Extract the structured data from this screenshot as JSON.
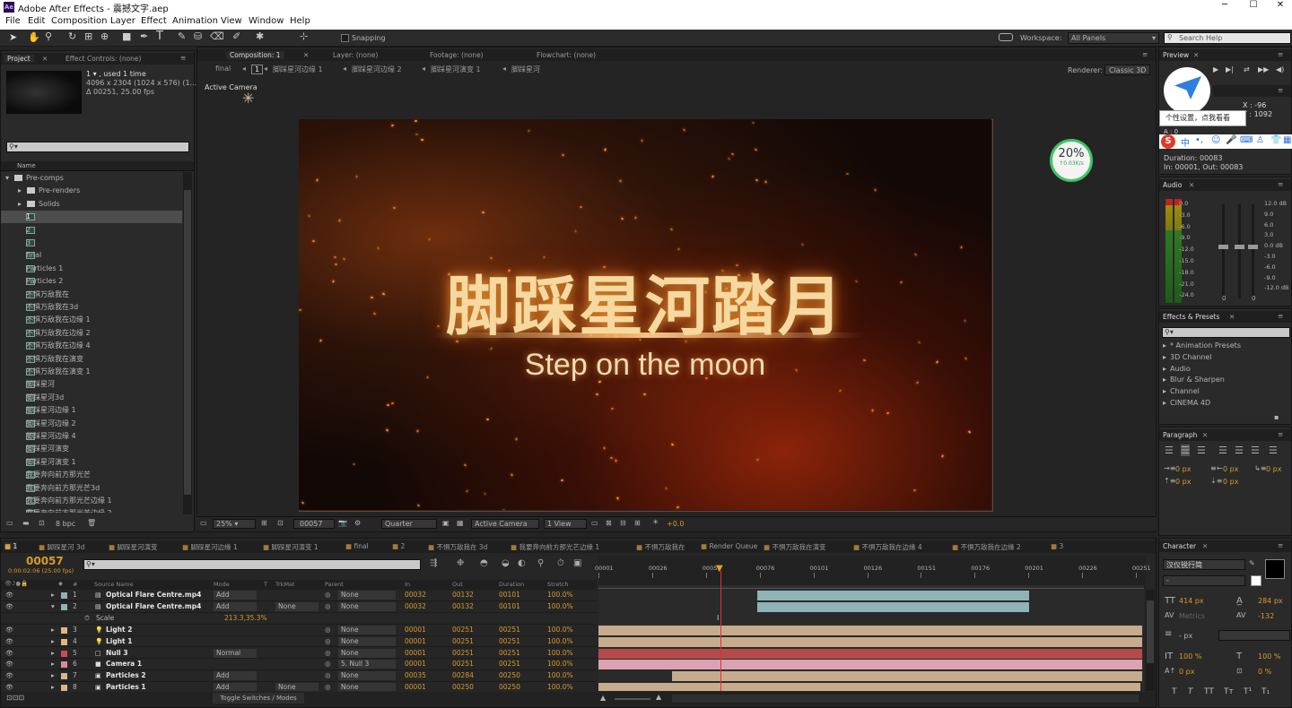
{
  "window": {
    "title": "Adobe After Effects - 震撼文字.aep"
  },
  "menu": [
    "File",
    "Edit",
    "Composition",
    "Layer",
    "Effect",
    "Animation",
    "View",
    "Window",
    "Help"
  ],
  "toolbar": {
    "snapping": "Snapping",
    "workspace_label": "Workspace:",
    "workspace_value": "All Panels",
    "search_placeholder": "Search Help"
  },
  "project": {
    "tab_project": "Project",
    "tab_effect_controls": "Effect Controls: (none)",
    "item_name": "1 ▾ , used 1 time",
    "item_size": "4096 x 2304  (1024 x 576) (1...",
    "item_duration": "Δ 00251, 25.00 fps",
    "col_name": "Name",
    "bpc": "8 bpc",
    "tree": [
      {
        "label": "Pre-comps",
        "level": 0,
        "kind": "folder",
        "open": true
      },
      {
        "label": "Pre-renders",
        "level": 1,
        "kind": "folder"
      },
      {
        "label": "Solids",
        "level": 1,
        "kind": "folder"
      },
      {
        "label": "1",
        "level": 1,
        "kind": "comp",
        "selected": true
      },
      {
        "label": "2",
        "level": 1,
        "kind": "comp"
      },
      {
        "label": "3",
        "level": 1,
        "kind": "comp"
      },
      {
        "label": "final",
        "level": 1,
        "kind": "comp"
      },
      {
        "label": "Particles 1",
        "level": 1,
        "kind": "comp"
      },
      {
        "label": "Particles 2",
        "level": 1,
        "kind": "comp"
      },
      {
        "label": "不惧万敌我在",
        "level": 1,
        "kind": "comp"
      },
      {
        "label": "不惧万敌我在3d",
        "level": 1,
        "kind": "comp"
      },
      {
        "label": "不惧万敌我在边缘 1",
        "level": 1,
        "kind": "comp"
      },
      {
        "label": "不惧万敌我在边缘 2",
        "level": 1,
        "kind": "comp"
      },
      {
        "label": "不惧万敌我在边缘 4",
        "level": 1,
        "kind": "comp"
      },
      {
        "label": "不惧万敌我在演变",
        "level": 1,
        "kind": "comp"
      },
      {
        "label": "不惧万敌我在演变 1",
        "level": 1,
        "kind": "comp"
      },
      {
        "label": "脚踩星河",
        "level": 1,
        "kind": "comp"
      },
      {
        "label": "脚踩星河3d",
        "level": 1,
        "kind": "comp"
      },
      {
        "label": "脚踩星河边缘 1",
        "level": 1,
        "kind": "comp"
      },
      {
        "label": "脚踩星河边缘 2",
        "level": 1,
        "kind": "comp"
      },
      {
        "label": "脚踩星河边缘 4",
        "level": 1,
        "kind": "comp"
      },
      {
        "label": "脚踩星河演变",
        "level": 1,
        "kind": "comp"
      },
      {
        "label": "脚踩星河演变 1",
        "level": 1,
        "kind": "comp"
      },
      {
        "label": "我要奔向前方那光芒",
        "level": 1,
        "kind": "comp"
      },
      {
        "label": "我要奔向前方那光芒3d",
        "level": 1,
        "kind": "comp"
      },
      {
        "label": "我要奔向前方那光芒边缘 1",
        "level": 1,
        "kind": "comp"
      },
      {
        "label": "我要奔向前方那光芒边缘 2",
        "level": 1,
        "kind": "comp"
      }
    ]
  },
  "viewer": {
    "tab_composition": "Composition: 1",
    "tab_layer": "Layer: (none)",
    "tab_footage": "Footage: (none)",
    "tab_flowchart": "Flowchart: (none)",
    "breadcrumb": [
      "final",
      "1",
      "脚踩星河边缘 1",
      "脚踩星河边缘 2",
      "脚踩星河演变 1",
      "脚踩星河"
    ],
    "renderer_label": "Renderer:",
    "renderer_value": "Classic 3D",
    "active_camera": "Active Camera",
    "title_cn": "脚踩星河踏月",
    "title_en": "Step on the moon",
    "speed_percent": "20%",
    "speed_rate": "0.03K/s",
    "zoom": "25%",
    "timecode": "00057",
    "resolution": "Quarter",
    "view_camera": "Active Camera",
    "view_layout": "1 View",
    "exposure": "+0.0"
  },
  "preview": {
    "tab": "Preview",
    "tooltip": "个性设置，点我看看",
    "info_x": "X : -96",
    "info_y": "Y : 1092",
    "info_a": "A : 0",
    "duration": "Duration: 00083",
    "in_out": "In: 00001, Out: 00083"
  },
  "audio": {
    "tab": "Audio",
    "left_scale": [
      "0.0",
      "-3.0",
      "-6.0",
      "-9.0",
      "-12.0",
      "-15.0",
      "-18.0",
      "-21.0",
      "-24.0"
    ],
    "right_scale": [
      "12.0 dB",
      "9.0",
      "6.0",
      "3.0",
      "0.0 dB",
      "-3.0",
      "-6.0",
      "-9.0",
      "-12.0 dB"
    ],
    "bottom_left": "0",
    "bottom_right": "0"
  },
  "effects": {
    "tab": "Effects & Presets",
    "items": [
      "* Animation Presets",
      "3D Channel",
      "Audio",
      "Blur & Sharpen",
      "Channel",
      "CINEMA 4D"
    ]
  },
  "paragraph": {
    "tab": "Paragraph",
    "values": [
      "0 px",
      "0 px",
      "0 px",
      "0 px",
      "0 px"
    ]
  },
  "character": {
    "tab": "Character",
    "font": "汉仪锐行简",
    "style": "-",
    "size": "414 px",
    "leading": "284 px",
    "tracking_label": "Metrics",
    "tracking": "-132",
    "stroke": "- px",
    "vscale": "100 %",
    "hscale": "100 %",
    "baseline": "0 px",
    "tsume": "0 %"
  },
  "timeline": {
    "tabs": [
      "1",
      "脚踩星河 3d",
      "脚踩星河演变",
      "脚踩星河边缘 1",
      "脚踩星河演变 1",
      "final",
      "2",
      "不惧万敌我在 3d",
      "我要奔向前方那光芒边缘 1",
      "不惧万敌我在",
      "Render Queue",
      "不惧万敌我在演变",
      "不惧万敌我在边缘 4",
      "不惧万敌我在边缘 2",
      "3"
    ],
    "timecode": "00057",
    "timecode_sub": "0:00:02:06 (25.00 fps)",
    "columns": [
      "#",
      "Source Name",
      "Mode",
      "T",
      "TrkMat",
      "Parent",
      "In",
      "Out",
      "Duration",
      "Stretch"
    ],
    "ruler": [
      "00001",
      "00026",
      "00051",
      "00076",
      "00101",
      "00126",
      "00151",
      "00176",
      "00201",
      "00226",
      "00251"
    ],
    "toggle": "Toggle Switches / Modes",
    "layers": [
      {
        "num": "1",
        "name": "Optical Flare Centre.mp4",
        "mode": "Add",
        "trkmat": "",
        "parent": "None",
        "in": "00032",
        "out": "00132",
        "dur": "00101",
        "stretch": "100.0%",
        "color": "#8fb3b6",
        "bar_start": 0.292,
        "bar_end": 0.792,
        "label": "#8fb3b6",
        "kind": "footage"
      },
      {
        "num": "2",
        "name": "Optical Flare Centre.mp4",
        "mode": "Add",
        "trkmat": "None",
        "parent": "None",
        "in": "00032",
        "out": "00132",
        "dur": "00101",
        "stretch": "100.0%",
        "color": "#8fb3b6",
        "bar_start": 0.292,
        "bar_end": 0.792,
        "label": "#8fb3b6",
        "kind": "footage",
        "open": true
      },
      {
        "num": "",
        "name": "Scale",
        "prop": "213.3,35.3%"
      },
      {
        "num": "3",
        "name": "Light 2",
        "mode": "",
        "trkmat": "",
        "parent": "None",
        "in": "00001",
        "out": "00251",
        "dur": "00251",
        "stretch": "100.0%",
        "color": "#c7ab8d",
        "bar_start": 0,
        "bar_end": 1,
        "label": "#e1b482",
        "kind": "light"
      },
      {
        "num": "4",
        "name": "Light 1",
        "mode": "",
        "trkmat": "",
        "parent": "None",
        "in": "00001",
        "out": "00251",
        "dur": "00251",
        "stretch": "100.0%",
        "color": "#c7ab8d",
        "bar_start": 0,
        "bar_end": 1,
        "label": "#e1b482",
        "kind": "light"
      },
      {
        "num": "5",
        "name": "Null 3",
        "mode": "Normal",
        "trkmat": "",
        "parent": "None",
        "in": "00001",
        "out": "00251",
        "dur": "00251",
        "stretch": "100.0%",
        "color": "#b54a4a",
        "bar_start": 0,
        "bar_end": 1,
        "label": "#c94c4c",
        "kind": "null"
      },
      {
        "num": "6",
        "name": "Camera 1",
        "mode": "",
        "trkmat": "",
        "parent": "5. Null 3",
        "in": "00001",
        "out": "00251",
        "dur": "00251",
        "stretch": "100.0%",
        "color": "#d9a3b3",
        "bar_start": 0,
        "bar_end": 1,
        "label": "#d98aa0",
        "kind": "camera"
      },
      {
        "num": "7",
        "name": "Particles 2",
        "mode": "Add",
        "trkmat": "",
        "parent": "None",
        "in": "00035",
        "out": "00284",
        "dur": "00250",
        "stretch": "100.0%",
        "color": "#c7ab8d",
        "bar_start": 0.136,
        "bar_end": 1,
        "label": "#d8b58a",
        "kind": "comp"
      },
      {
        "num": "8",
        "name": "Particles 1",
        "mode": "Add",
        "trkmat": "None",
        "parent": "None",
        "in": "00001",
        "out": "00250",
        "dur": "00250",
        "stretch": "100.0%",
        "color": "#c7ab8d",
        "bar_start": 0,
        "bar_end": 0.996,
        "label": "#d8b58a",
        "kind": "comp"
      }
    ]
  }
}
